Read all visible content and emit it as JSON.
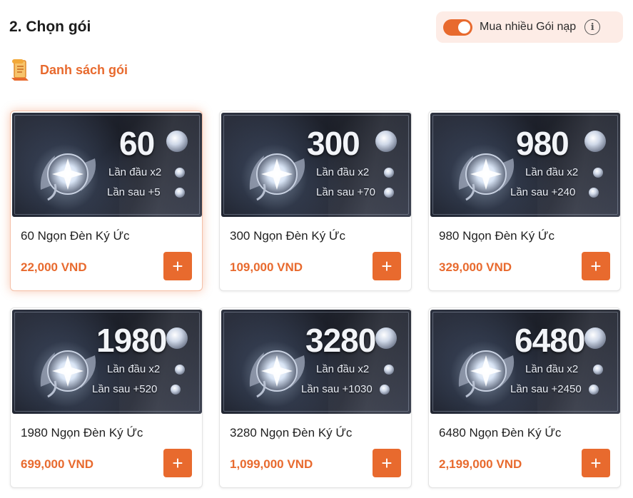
{
  "header": {
    "title": "2. Chọn gói",
    "toggle_label": "Mua nhiều Gói nạp",
    "toggle_on": true,
    "info_icon": "info-icon"
  },
  "section": {
    "label": "Danh sách gói",
    "icon": "package-list-icon"
  },
  "accent_color": "#e86a2e",
  "packages": [
    {
      "qty": "60",
      "first": "Lần đầu x2",
      "later": "Lần sau +5",
      "name": "60 Ngọn Đèn Ký Ức",
      "price": "22,000 VND",
      "add": "+",
      "selected": true
    },
    {
      "qty": "300",
      "first": "Lần đầu x2",
      "later": "Lần sau +70",
      "name": "300 Ngọn Đèn Ký Ức",
      "price": "109,000 VND",
      "add": "+",
      "selected": false
    },
    {
      "qty": "980",
      "first": "Lần đầu x2",
      "later": "Lần sau +240",
      "name": "980 Ngọn Đèn Ký Ức",
      "price": "329,000 VND",
      "add": "+",
      "selected": false
    },
    {
      "qty": "1980",
      "first": "Lần đầu x2",
      "later": "Lần sau +520",
      "name": "1980 Ngọn Đèn Ký Ức",
      "price": "699,000 VND",
      "add": "+",
      "selected": false
    },
    {
      "qty": "3280",
      "first": "Lần đầu x2",
      "later": "Lần sau +1030",
      "name": "3280 Ngọn Đèn Ký Ức",
      "price": "1,099,000 VND",
      "add": "+",
      "selected": false
    },
    {
      "qty": "6480",
      "first": "Lần đầu x2",
      "later": "Lần sau +2450",
      "name": "6480 Ngọn Đèn Ký Ức",
      "price": "2,199,000 VND",
      "add": "+",
      "selected": false
    }
  ]
}
